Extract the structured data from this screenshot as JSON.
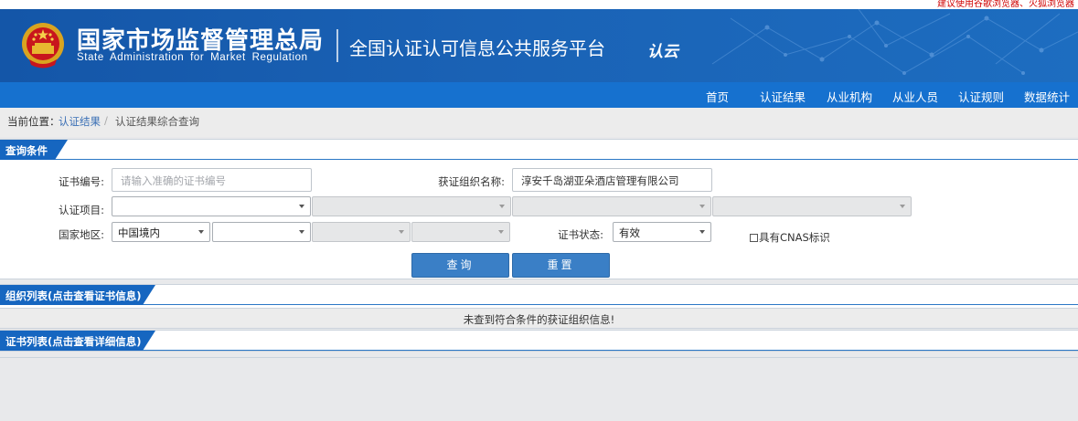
{
  "browser_tip": "建议使用谷歌浏览器、火狐浏览器",
  "header": {
    "agency_cn": "国家市场监督管理总局",
    "agency_en": "State Administration for Market Regulation",
    "platform_title": "全国认证认可信息公共服务平台",
    "brand_text": "认云",
    "colors": {
      "header_bg": "#1456a8",
      "nav_bg": "#1671cf"
    }
  },
  "nav": [
    "首页",
    "认证结果",
    "从业机构",
    "从业人员",
    "认证规则",
    "数据统计"
  ],
  "breadcrumb": {
    "prefix": "当前位置：",
    "link": "认证结果",
    "separator": "/",
    "current": "认证结果综合查询"
  },
  "query": {
    "title": "查询条件",
    "cert_no_label": "证书编号:",
    "cert_no_placeholder": "请输入准确的证书编号",
    "org_name_label": "获证组织名称:",
    "org_name_value": "淳安千岛湖亚朵酒店管理有限公司",
    "item_label": "认证项目:",
    "region_label": "国家地区:",
    "region_value": "中国境内",
    "status_label": "证书状态:",
    "status_value": "有效",
    "cnas_label": "具有CNAS标识",
    "search_button": "查询",
    "reset_button": "重置"
  },
  "org_list": {
    "title": "组织列表(点击查看证书信息)",
    "empty_message": "未查到符合条件的获证组织信息!"
  },
  "cert_list": {
    "title": "证书列表(点击查看详细信息)"
  }
}
